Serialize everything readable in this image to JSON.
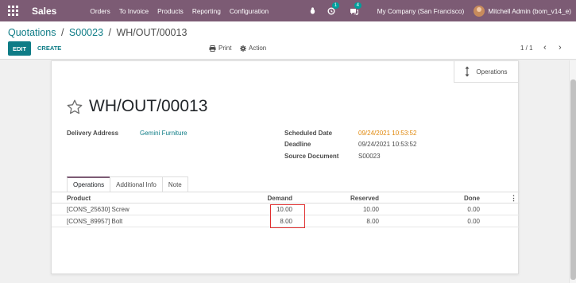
{
  "navbar": {
    "brand": "Sales",
    "menu": [
      "Orders",
      "To Invoice",
      "Products",
      "Reporting",
      "Configuration"
    ],
    "activity_count": "1",
    "message_count": "4",
    "company": "My Company (San Francisco)",
    "user": "Mitchell Admin (bom_v14_e)"
  },
  "breadcrumb": {
    "crumb1": "Quotations",
    "crumb2": "S00023",
    "current": "WH/OUT/00013",
    "separator": "/"
  },
  "toolbar": {
    "edit_label": "EDIT",
    "create_label": "CREATE",
    "print_label": "Print",
    "action_label": "Action",
    "pager": "1 / 1"
  },
  "sheet": {
    "operations_button": "Operations",
    "title": "WH/OUT/00013",
    "delivery_address_label": "Delivery Address",
    "delivery_address_value": "Gemini Furniture",
    "scheduled_date_label": "Scheduled Date",
    "scheduled_date_value": "09/24/2021 10:53:52",
    "deadline_label": "Deadline",
    "deadline_value": "09/24/2021 10:53:52",
    "source_document_label": "Source Document",
    "source_document_value": "S00023"
  },
  "tabs": [
    "Operations",
    "Additional Info",
    "Note"
  ],
  "table": {
    "headers": {
      "product": "Product",
      "demand": "Demand",
      "reserved": "Reserved",
      "done": "Done"
    },
    "rows": [
      {
        "product": "[CONS_25630] Screw",
        "demand": "10.00",
        "reserved": "10.00",
        "done": "0.00"
      },
      {
        "product": "[CONS_89957] Bolt",
        "demand": "8.00",
        "reserved": "8.00",
        "done": "0.00"
      }
    ]
  },
  "colors": {
    "navbar": "#7c5b74",
    "accent": "#0e7c86",
    "scheduled_date": "#e0880c",
    "highlight_box": "#e03030"
  }
}
